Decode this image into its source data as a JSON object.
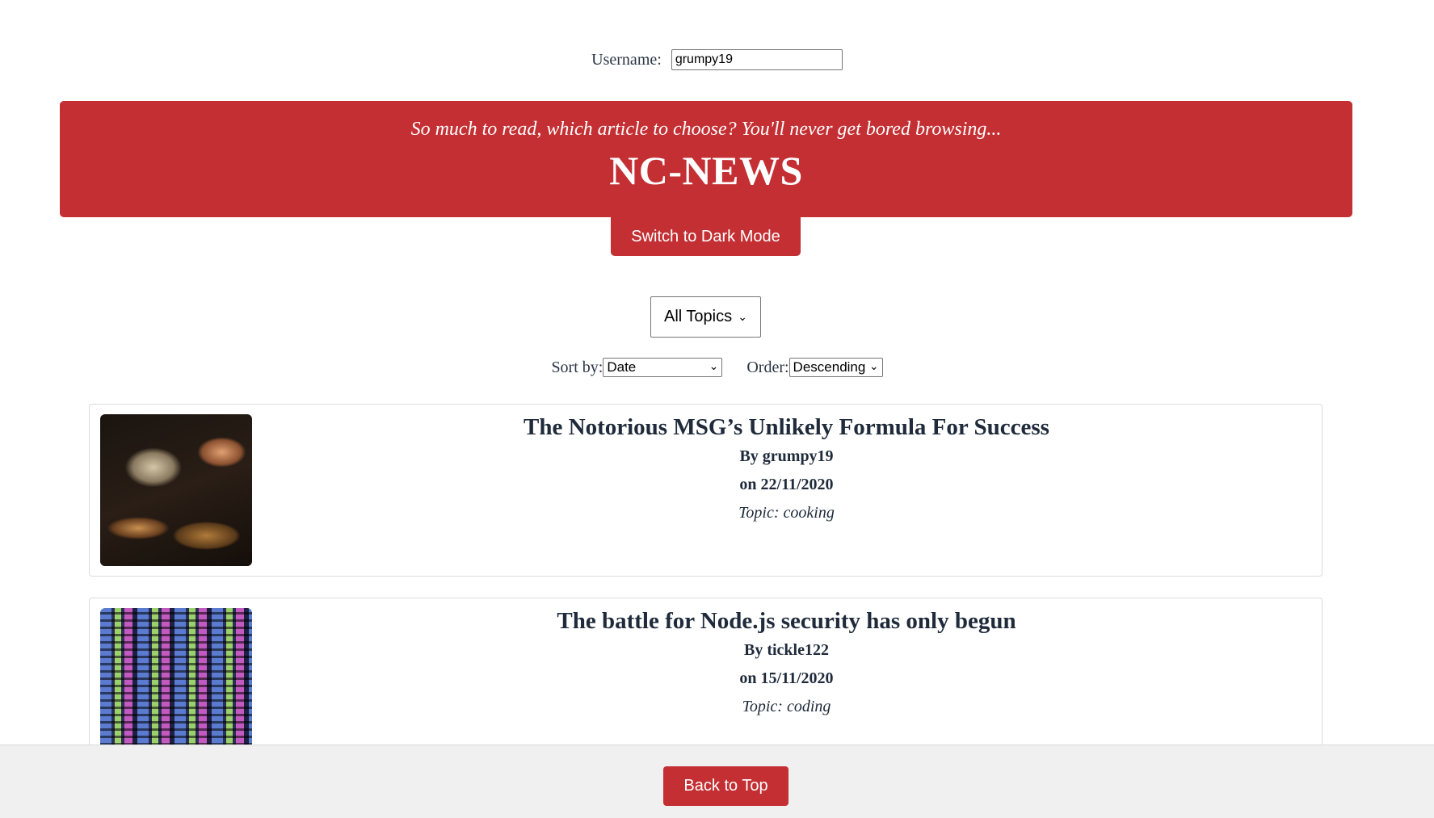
{
  "user": {
    "label": "Username:",
    "value": "grumpy19"
  },
  "banner": {
    "tagline": "So much to read, which article to choose? You'll never get bored browsing...",
    "title": "NC-NEWS"
  },
  "theme_button": "Switch to Dark Mode",
  "topic_filter": {
    "selected": "All Topics"
  },
  "sort": {
    "label": "Sort by:",
    "selected": "Date"
  },
  "order": {
    "label": "Order:",
    "selected": "Descending"
  },
  "articles": [
    {
      "title": "The Notorious MSG’s Unlikely Formula For Success",
      "author": "By grumpy19",
      "date": "on 22/11/2020",
      "topic": "Topic: cooking",
      "image": "cooking-photo"
    },
    {
      "title": "The battle for Node.js security has only begun",
      "author": "By tickle122",
      "date": "on 15/11/2020",
      "topic": "Topic: coding",
      "image": "code-screen-photo"
    }
  ],
  "footer": {
    "back_to_top": "Back to Top"
  },
  "colors": {
    "accent": "#c42f33",
    "footer_bg": "#f0f0f0"
  }
}
